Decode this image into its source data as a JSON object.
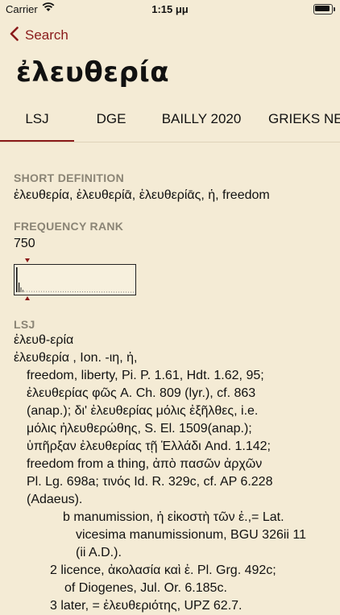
{
  "status_bar": {
    "carrier": "Carrier",
    "time": "1:15 μμ"
  },
  "nav": {
    "back_label": "Search"
  },
  "headword": "ἐλευθερία",
  "tabs": [
    "LSJ",
    "DGE",
    "BAILLY 2020",
    "GRIEKS NED"
  ],
  "active_tab": "LSJ",
  "short_definition": {
    "label": "SHORT DEFINITION",
    "text": "ἐλευθερία, ἐλευθερίᾱ, ἐλευθερίᾱς, ἡ, freedom"
  },
  "frequency": {
    "label": "FREQUENCY RANK",
    "rank": "750"
  },
  "lsj": {
    "label": "LSJ",
    "lines": [
      "ἐλευθ-ερία",
      "ἐλευθερία , Ion. -ιη, ἡ,",
      "freedom, liberty, Pi. P. 1.61, Hdt. 1.62, 95;",
      "ἐλευθερίας φῶς A. Ch. 809 (lyr.), cf. 863",
      "(anap.); δι' ἐλευθερίας μόλις ἐξῆλθες, i.e.",
      "μόλις ἠλευθερώθης, S. El. 1509(anap.);",
      "ὑπῆρξαν ἐλευθερίας τῇ Ἑλλάδι And. 1.142;",
      "freedom from a thing, ἀπὸ πασῶν ἀρχῶν",
      "Pl. Lg. 698a; τινός Id. R. 329c, cf. AP 6.228",
      "(Adaeus).",
      "b manumission, ἡ εἰκοστὴ τῶν ἐ.,= Lat.",
      "vicesima manumissionum, BGU 326ii 11",
      "(ii A.D.).",
      "2 licence, ἀκολασία καὶ ἐ. Pl. Grg. 492c;",
      "of Diogenes, Jul. Or. 6.185c.",
      "3 later, = ἐλευθεριότης, UPZ 62.7."
    ]
  },
  "colors": {
    "accent": "#8a1a1a",
    "background": "#f4ebd5",
    "label": "#8a8475"
  }
}
